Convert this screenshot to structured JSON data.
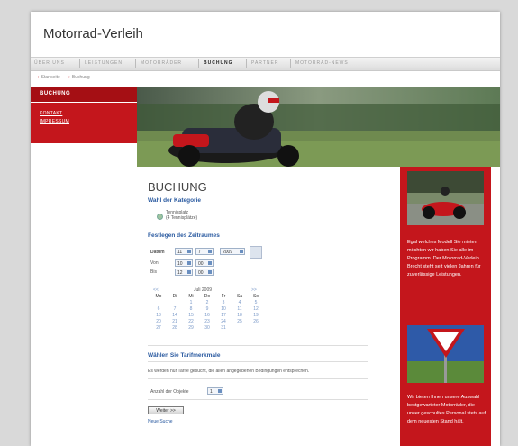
{
  "site": {
    "title": "Motorrad-Verleih"
  },
  "nav": {
    "items": [
      {
        "label": "ÜBER UNS",
        "active": false
      },
      {
        "label": "LEISTUNGEN",
        "active": false
      },
      {
        "label": "MOTORRÄDER",
        "active": false
      },
      {
        "label": "BUCHUNG",
        "active": true
      },
      {
        "label": "PARTNER",
        "active": false
      },
      {
        "label": "MOTORRAD-NEWS",
        "active": false
      }
    ]
  },
  "breadcrumb": [
    "Startseite",
    "Buchung"
  ],
  "sidebar": {
    "heading": "BUCHUNG",
    "links": [
      "KONTAKT",
      "IMPRESSUM"
    ]
  },
  "main": {
    "title": "BUCHUNG",
    "category": {
      "heading": "Wahl der Kategorie",
      "option_line1": "Tennisplatz",
      "option_line2": "(4 Tennisplätze)"
    },
    "period": {
      "heading": "Festlegen des Zeitraumes",
      "date_label": "Datum",
      "day": "11",
      "month": "7",
      "year": "2009",
      "from_label": "Von",
      "from_h": "10",
      "from_m": "00",
      "to_label": "Bis",
      "to_h": "12",
      "to_m": "00"
    },
    "calendar": {
      "prev": "<<",
      "next": ">>",
      "month": "Juli 2009",
      "weekdays": [
        "Mo",
        "Di",
        "Mi",
        "Do",
        "Fr",
        "Sa",
        "So"
      ],
      "weeks": [
        [
          "",
          "",
          "1",
          "2",
          "3",
          "4",
          "5"
        ],
        [
          "6",
          "7",
          "8",
          "9",
          "10",
          "11",
          "12"
        ],
        [
          "13",
          "14",
          "15",
          "16",
          "17",
          "18",
          "19"
        ],
        [
          "20",
          "21",
          "22",
          "23",
          "24",
          "25",
          "26"
        ],
        [
          "27",
          "28",
          "29",
          "30",
          "31",
          "",
          ""
        ]
      ]
    },
    "tariff": {
      "heading": "Wählen Sie Tarifmerkmale",
      "info": "Es werden nur Tarife gesucht, die allen angegebenen Bedingungen entsprechen.",
      "count_label": "Anzahl der Objekte",
      "count_value": "1"
    },
    "next_button": "Weiter >>",
    "new_search": "Neue Suche"
  },
  "right": {
    "text1": "Egal welches Modell Sie mieten möchten wir haben Sie alle im Programm. Der Motorrad-Verleih Brecht steht seit vielen Jahren für zuverlässige Leistungen.",
    "text2": "Wir bieten Ihnen unsere Auswahl bestgewarteter Motorräder, die unser geschultes Personal stets auf dem neuesten Stand hält."
  },
  "colors": {
    "brand_red": "#c4161c",
    "link_blue": "#2a5aa0"
  }
}
